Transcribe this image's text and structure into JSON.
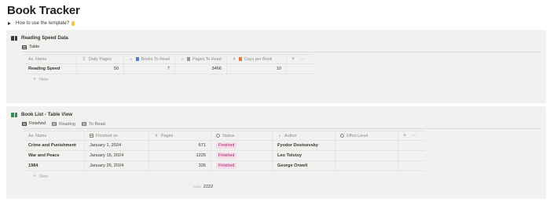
{
  "page": {
    "title": "Book Tracker",
    "toggle_label": "How to use the template?"
  },
  "reading_speed": {
    "title": "Reading Speed Data",
    "tabs": [
      {
        "label": "Table",
        "active": true
      }
    ],
    "columns": [
      {
        "icon": "Aa",
        "label": "Name"
      },
      {
        "icon": "Σ",
        "label": "Daily Pages"
      },
      {
        "icon": "search-icon",
        "label": "Books To Read"
      },
      {
        "icon": "search-icon",
        "label": "Pages To Read"
      },
      {
        "icon": "#",
        "label": "Days per Book"
      }
    ],
    "rows": [
      {
        "name": "Reading Speed",
        "daily_pages": "50",
        "books_to_read": "7",
        "pages_to_read": "3466",
        "days_per_book": "10"
      }
    ],
    "new_label": "New"
  },
  "book_list": {
    "title": "Book List - Table View",
    "tabs": [
      {
        "label": "Finished",
        "active": true
      },
      {
        "label": "Reading",
        "active": false
      },
      {
        "label": "To Read",
        "active": false
      }
    ],
    "columns": [
      {
        "icon": "Aa",
        "label": "Name"
      },
      {
        "icon": "calendar-icon",
        "label": "Finished on"
      },
      {
        "icon": "#",
        "label": "Pages"
      },
      {
        "icon": "status-icon",
        "label": "Status"
      },
      {
        "icon": "search-icon",
        "label": "Author"
      },
      {
        "icon": "formula-icon",
        "label": "Effort Level"
      }
    ],
    "rows": [
      {
        "name": "Crime and Punishment",
        "finished_on": "January 1, 2024",
        "pages": "671",
        "status": "Finished",
        "author": "Fyodor Dostoevsky",
        "effort": ""
      },
      {
        "name": "War and Peace",
        "finished_on": "January 16, 2024",
        "pages": "1225",
        "status": "Finished",
        "author": "Leo Tolstoy",
        "effort": ""
      },
      {
        "name": "1984",
        "finished_on": "January 26, 2024",
        "pages": "326",
        "status": "Finished",
        "author": "George Orwell",
        "effort": ""
      }
    ],
    "new_label": "New",
    "sum_label": "SUM",
    "sum_value": "2222"
  },
  "colors": {
    "status_bg": "#f6dde8",
    "status_text": "#ad1a72",
    "block_bg": "#f1f1ef"
  }
}
